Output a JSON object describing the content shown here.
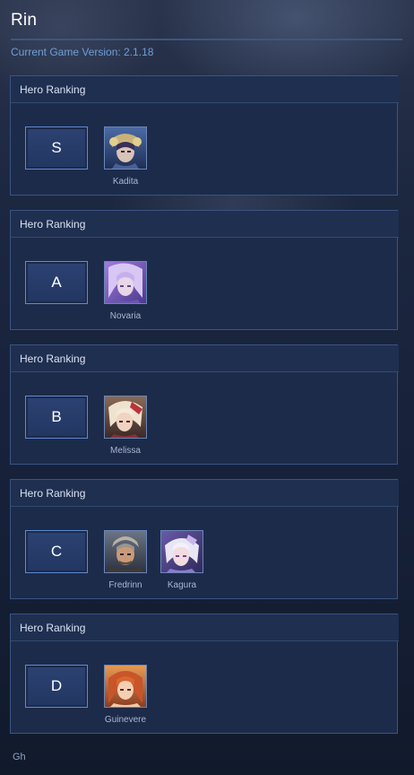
{
  "app": {
    "title": "Rin",
    "version_text": "Current Game Version: 2.1.18",
    "footer_text": "Gh"
  },
  "tiers": [
    {
      "header": "Hero Ranking",
      "rank": "S",
      "heroes": [
        {
          "name": "Kadita"
        }
      ]
    },
    {
      "header": "Hero Ranking",
      "rank": "A",
      "heroes": [
        {
          "name": "Novaria"
        }
      ]
    },
    {
      "header": "Hero Ranking",
      "rank": "B",
      "heroes": [
        {
          "name": "Melissa"
        }
      ]
    },
    {
      "header": "Hero Ranking",
      "rank": "C",
      "heroes": [
        {
          "name": "Fredrinn"
        },
        {
          "name": "Kagura"
        }
      ]
    },
    {
      "header": "Hero Ranking",
      "rank": "D",
      "heroes": [
        {
          "name": "Guinevere"
        }
      ]
    }
  ],
  "colors": {
    "accent": "#6f9fd6",
    "card_bg": "#1d2b4a",
    "card_border": "#3a5482",
    "badge_border": "#5f8ad0"
  }
}
